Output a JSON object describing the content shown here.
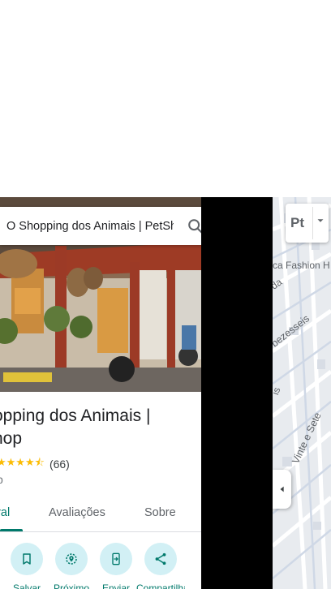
{
  "search": {
    "value": "O Shopping dos Animais | PetShop",
    "search_icon": "search-icon",
    "close_icon": "close-icon"
  },
  "place": {
    "title": "opping dos Animais | hop",
    "title_line1": "opping dos Animais |",
    "title_line2": "hop",
    "stars_text": "★★★★⯪",
    "rating_count": "(66)",
    "category": "p"
  },
  "tabs": {
    "overview": "eral",
    "reviews": "Avaliações",
    "about": "Sobre"
  },
  "actions": [
    {
      "label": "Salvar",
      "icon": "bookmark-icon"
    },
    {
      "label": "Próximo",
      "icon": "nearby-icon"
    },
    {
      "label": "Enviar",
      "icon": "send-to-phone-icon"
    },
    {
      "label": "Compartilhar",
      "icon": "share-icon"
    }
  ],
  "map": {
    "layers_label": "Pt",
    "labels": {
      "fashion": "ca Fashion H",
      "street1": "bezesseis",
      "street2": "Vinte e Sete",
      "street3": "da",
      "street4": "is"
    }
  },
  "colors": {
    "accent": "#00796b",
    "action_bg": "#d2f0f5",
    "star": "#fbbc04"
  }
}
